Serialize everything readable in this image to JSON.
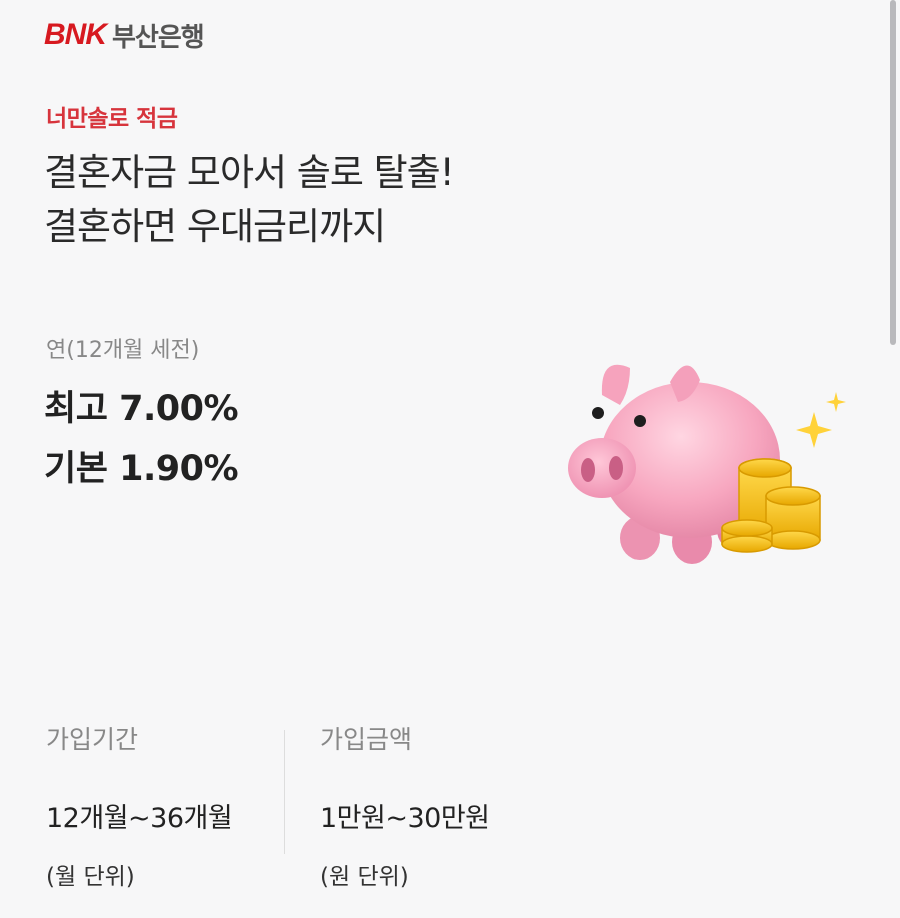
{
  "header": {
    "brand_mark": "BNK",
    "brand_name": "부산은행"
  },
  "product": {
    "name": "너만솔로 적금",
    "headline": [
      "결혼자금 모아서 솔로 탈출!",
      "결혼하면 우대금리까지"
    ]
  },
  "rates": {
    "caption": "연(12개월 세전)",
    "max": "최고 7.00%",
    "base": "기본 1.90%"
  },
  "illustration": {
    "icon": "piggy-bank-with-coins"
  },
  "terms": {
    "period": {
      "label": "가입기간",
      "value": "12개월~36개월",
      "unit": "(월 단위)"
    },
    "amount": {
      "label": "가입금액",
      "value": "1만원~30만원",
      "unit": "(원 단위)"
    }
  },
  "colors": {
    "brand": "#d71920",
    "accent": "#d7343c",
    "background": "#f7f7f8"
  }
}
